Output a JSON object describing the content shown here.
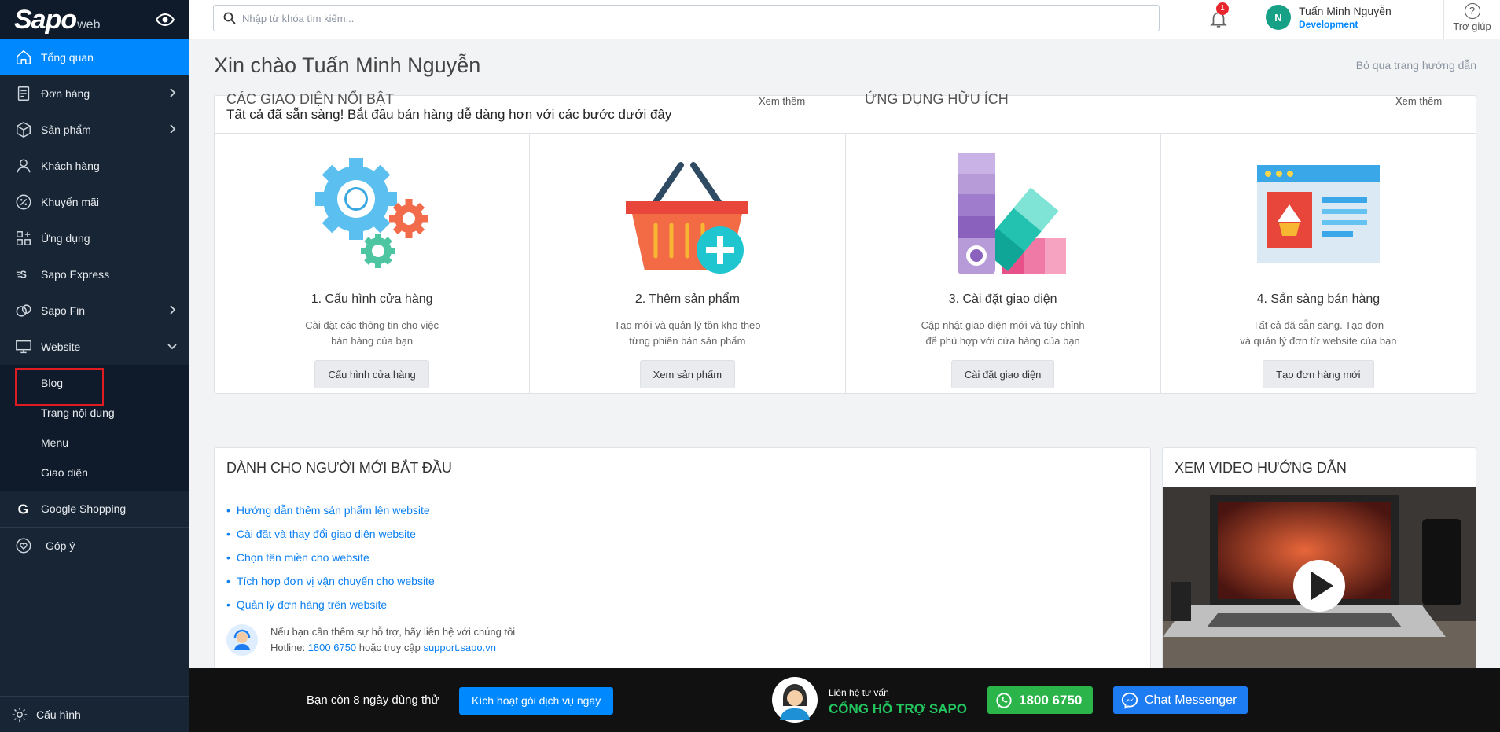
{
  "sidebar": {
    "logo_main": "Sapo",
    "logo_sub": "web",
    "items": [
      {
        "label": "Tổng quan"
      },
      {
        "label": "Đơn hàng"
      },
      {
        "label": "Sản phẩm"
      },
      {
        "label": "Khách hàng"
      },
      {
        "label": "Khuyến mãi"
      },
      {
        "label": "Ứng dụng"
      },
      {
        "label": "Sapo Express"
      },
      {
        "label": "Sapo Fin"
      },
      {
        "label": "Website"
      },
      {
        "label": "Google Shopping"
      },
      {
        "label": "Góp ý"
      }
    ],
    "website_sub": [
      {
        "label": "Blog"
      },
      {
        "label": "Trang nội dung"
      },
      {
        "label": "Menu"
      },
      {
        "label": "Giao diện"
      }
    ],
    "footer": "Cấu hình"
  },
  "header": {
    "search_placeholder": "Nhập từ khóa tìm kiếm...",
    "notification_count": "1",
    "user_initial": "N",
    "user_name": "Tuấn Minh Nguyễn",
    "user_role": "Development",
    "help": "Trợ giúp"
  },
  "main": {
    "greeting": "Xin chào Tuấn Minh Nguyễn",
    "skip": "Bỏ qua trang hướng dẫn",
    "steps_title": "Tất cả đã sẵn sàng! Bắt đầu bán hàng dễ dàng hơn với các bước dưới đây",
    "steps": [
      {
        "title": "1. Cấu hình cửa hàng",
        "desc1": "Cài đặt các thông tin cho việc",
        "desc2": "bán hàng của bạn",
        "button": "Cấu hình cửa hàng"
      },
      {
        "title": "2. Thêm sản phẩm",
        "desc1": "Tạo mới và quản lý tồn kho theo",
        "desc2": "từng phiên bản sản phẩm",
        "button": "Xem sản phẩm"
      },
      {
        "title": "3. Cài đặt giao diện",
        "desc1": "Cập nhật giao diện mới và tùy chỉnh",
        "desc2": "để phù hợp với cửa hàng của bạn",
        "button": "Cài đặt giao diện"
      },
      {
        "title": "4. Sẵn sàng bán hàng",
        "desc1": "Tất cả đã sẵn sàng. Tạo đơn",
        "desc2": "và quản lý đơn từ website của bạn",
        "button": "Tạo đơn hàng mới"
      }
    ],
    "begin_title": "DÀNH CHO NGƯỜI MỚI BẮT ĐẦU",
    "begin_links": [
      "Hướng dẫn thêm sản phẩm lên website",
      "Cài đặt và thay đổi giao diện website",
      "Chọn tên miền cho website",
      "Tích hợp đơn vị vận chuyển cho website",
      "Quản lý đơn hàng trên website"
    ],
    "support_line1": "Nếu bạn cần thêm sự hỗ trợ, hãy liên hệ với chúng tôi",
    "support_hotline_label": "Hotline:",
    "support_hotline": "1800 6750",
    "support_or": "hoặc truy cập",
    "support_site": "support.sapo.vn",
    "video_title": "XEM VIDEO HƯỚNG DẪN",
    "below_left": "CÁC GIAO DIỆN NỔI BẬT",
    "below_left_more": "Xem thêm",
    "below_right": "ỨNG DỤNG HỮU ÍCH",
    "below_right_more": "Xem thêm"
  },
  "bottombar": {
    "trial": "Bạn còn 8 ngày dùng thử",
    "activate": "Kích hoạt gói dịch vụ ngay",
    "contact_small": "Liên hệ tư vấn",
    "contact_big": "CỔNG HỖ TRỢ SAPO",
    "phone": "1800 6750",
    "messenger": "Chat Messenger"
  },
  "colors": {
    "sidebar_bg": "#182535",
    "accent": "#0088ff",
    "whatsapp_green": "#2bb44a",
    "messenger_blue": "#1e7cf2"
  }
}
